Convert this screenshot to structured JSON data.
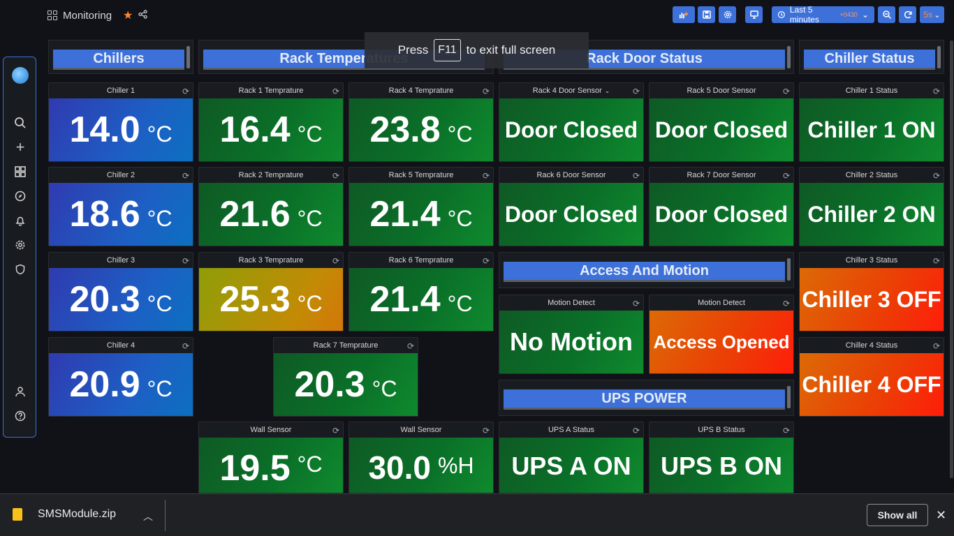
{
  "header": {
    "title": "Monitoring",
    "time_range": "Last 5 minutes",
    "timezone": "+0430",
    "refresh_interval": "5s"
  },
  "toast": {
    "before": "Press",
    "key": "F11",
    "after": "to exit full screen"
  },
  "rows": {
    "chillers": "Chillers",
    "rack_temperatures": "Rack Temperatures",
    "rack_door_status": "Rack Door Status",
    "chiller_status": "Chiller Status",
    "access_motion": "Access And Motion",
    "ups_power": "UPS POWER"
  },
  "panels": {
    "chiller1": {
      "title": "Chiller 1",
      "value": "14.0",
      "unit": "°C"
    },
    "chiller2": {
      "title": "Chiller 2",
      "value": "18.6",
      "unit": "°C"
    },
    "chiller3": {
      "title": "Chiller 3",
      "value": "20.3",
      "unit": "°C"
    },
    "chiller4": {
      "title": "Chiller 4",
      "value": "20.9",
      "unit": "°C"
    },
    "rack1": {
      "title": "Rack 1 Temprature",
      "value": "16.4",
      "unit": "°C"
    },
    "rack2": {
      "title": "Rack 2 Temprature",
      "value": "21.6",
      "unit": "°C"
    },
    "rack3": {
      "title": "Rack 3 Temprature",
      "value": "25.3",
      "unit": "°C"
    },
    "rack4": {
      "title": "Rack 4 Temprature",
      "value": "23.8",
      "unit": "°C"
    },
    "rack5": {
      "title": "Rack 5 Temprature",
      "value": "21.4",
      "unit": "°C"
    },
    "rack6": {
      "title": "Rack 6 Temprature",
      "value": "21.4",
      "unit": "°C"
    },
    "rack7": {
      "title": "Rack 7 Temprature",
      "value": "20.3",
      "unit": "°C"
    },
    "wall_temp": {
      "title": "Wall Sensor",
      "value": "19.5",
      "unit": "°C"
    },
    "wall_hum": {
      "title": "Wall Sensor",
      "value": "30.0",
      "unit": "%H"
    },
    "door4": {
      "title": "Rack 4 Door Sensor",
      "value": "Door Closed"
    },
    "door5": {
      "title": "Rack 5 Door Sensor",
      "value": "Door Closed"
    },
    "door6": {
      "title": "Rack 6 Door Sensor",
      "value": "Door Closed"
    },
    "door7": {
      "title": "Rack 7 Door Sensor",
      "value": "Door Closed"
    },
    "motion1": {
      "title": "Motion Detect",
      "value": "No Motion"
    },
    "motion2": {
      "title": "Motion Detect",
      "value": "Access Opened"
    },
    "ups_a": {
      "title": "UPS A Status",
      "value": "UPS A ON"
    },
    "ups_b": {
      "title": "UPS B Status",
      "value": "UPS B ON"
    },
    "cs1": {
      "title": "Chiller 1 Status",
      "value": "Chiller 1 ON"
    },
    "cs2": {
      "title": "Chiller 2 Status",
      "value": "Chiller 2 ON"
    },
    "cs3": {
      "title": "Chiller 3 Status",
      "value": "Chiller 3 OFF"
    },
    "cs4": {
      "title": "Chiller 4 Status",
      "value": "Chiller 4 OFF"
    }
  },
  "downloads": {
    "file": "SMSModule.zip",
    "show_all": "Show all"
  },
  "colors": {
    "accent": "#3d71d9",
    "green": "#0a7028",
    "blue": "#1d5fc4",
    "amber": "#c38a05",
    "red": "#ec3d05"
  }
}
